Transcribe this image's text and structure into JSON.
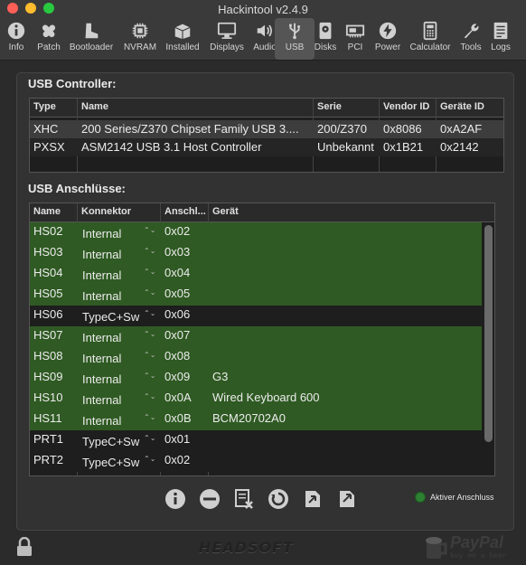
{
  "window": {
    "title": "Hackintool v2.4.9"
  },
  "toolbar": {
    "items": [
      {
        "label": "Info",
        "icon": "info-icon"
      },
      {
        "label": "Patch",
        "icon": "bandage-icon"
      },
      {
        "label": "Bootloader",
        "icon": "boot-icon"
      },
      {
        "label": "NVRAM",
        "icon": "chip-icon"
      },
      {
        "label": "Installed",
        "icon": "box-icon"
      },
      {
        "label": "Displays",
        "icon": "monitor-icon"
      },
      {
        "label": "Audio",
        "icon": "speaker-icon"
      },
      {
        "label": "USB",
        "icon": "usb-icon",
        "active": true
      },
      {
        "label": "Disks",
        "icon": "disk-icon"
      },
      {
        "label": "PCI",
        "icon": "pci-card-icon"
      },
      {
        "label": "Power",
        "icon": "power-bolt-icon"
      },
      {
        "label": "Calculator",
        "icon": "calculator-icon"
      },
      {
        "label": "Tools",
        "icon": "wrench-icon"
      },
      {
        "label": "Logs",
        "icon": "logs-icon"
      }
    ]
  },
  "controller": {
    "title": "USB Controller:",
    "columns": [
      "Type",
      "Name",
      "Serie",
      "Vendor ID",
      "Geräte ID"
    ],
    "rows": [
      {
        "type": "XHC",
        "name": "200 Series/Z370 Chipset Family USB 3....",
        "serie": "200/Z370",
        "vendor": "0x8086",
        "device": "0xA2AF"
      },
      {
        "type": "PXSX",
        "name": "ASM2142 USB 3.1 Host Controller",
        "serie": "Unbekannt",
        "vendor": "0x1B21",
        "device": "0x2142"
      }
    ]
  },
  "ports": {
    "title": "USB Anschlüsse:",
    "columns": [
      "Name",
      "Konnektor",
      "Anschl...",
      "Gerät"
    ],
    "rows": [
      {
        "name": "HS02",
        "connector": "Internal",
        "port": "0x02",
        "device": "",
        "active": true
      },
      {
        "name": "HS03",
        "connector": "Internal",
        "port": "0x03",
        "device": "",
        "active": true
      },
      {
        "name": "HS04",
        "connector": "Internal",
        "port": "0x04",
        "device": "",
        "active": true
      },
      {
        "name": "HS05",
        "connector": "Internal",
        "port": "0x05",
        "device": "",
        "active": true
      },
      {
        "name": "HS06",
        "connector": "TypeC+Sw",
        "port": "0x06",
        "device": "",
        "active": false
      },
      {
        "name": "HS07",
        "connector": "Internal",
        "port": "0x07",
        "device": "",
        "active": true
      },
      {
        "name": "HS08",
        "connector": "Internal",
        "port": "0x08",
        "device": "",
        "active": true
      },
      {
        "name": "HS09",
        "connector": "Internal",
        "port": "0x09",
        "device": "G3",
        "active": true
      },
      {
        "name": "HS10",
        "connector": "Internal",
        "port": "0x0A",
        "device": "Wired Keyboard 600",
        "active": true
      },
      {
        "name": "HS11",
        "connector": "Internal",
        "port": "0x0B",
        "device": "BCM20702A0",
        "active": true
      },
      {
        "name": "PRT1",
        "connector": "TypeC+Sw",
        "port": "0x01",
        "device": "",
        "active": false
      },
      {
        "name": "PRT2",
        "connector": "TypeC+Sw",
        "port": "0x02",
        "device": "",
        "active": false
      }
    ]
  },
  "legend": {
    "active_label": "Aktiver Anschluss",
    "active_color": "#2f5a23"
  },
  "footer": {
    "brand": "HEADSOFT",
    "paypal": "PayPal",
    "paypal_tagline": "buy me a beer"
  }
}
